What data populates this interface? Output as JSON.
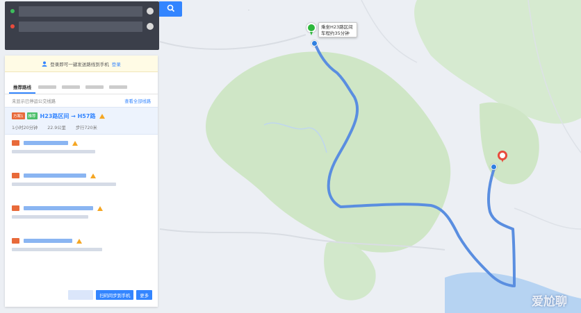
{
  "panel": {
    "login_prompt": "登录即可一键发送路线到手机",
    "login_link": "登录",
    "tabs": [
      "推荐路线"
    ],
    "info_text": "未显示已停运公交线路",
    "info_link": "查看全部线路",
    "first_route": {
      "plan_badge": "方案1",
      "type_badge": "推荐",
      "name": "H23路区间 → H57路",
      "duration": "1小时20分钟",
      "distance": "22.9公里",
      "walk": "步行720米"
    },
    "footer": {
      "send_button": "扫码同步到手机",
      "more_button": "更多"
    }
  },
  "map": {
    "callout_line1": "乘坐H23路区间",
    "callout_line2": "车程约35分钟",
    "start_icon": "bus-start-icon",
    "end_icon": "destination-icon",
    "route_color": "#5a8ee0"
  },
  "watermark": "爱尬聊"
}
